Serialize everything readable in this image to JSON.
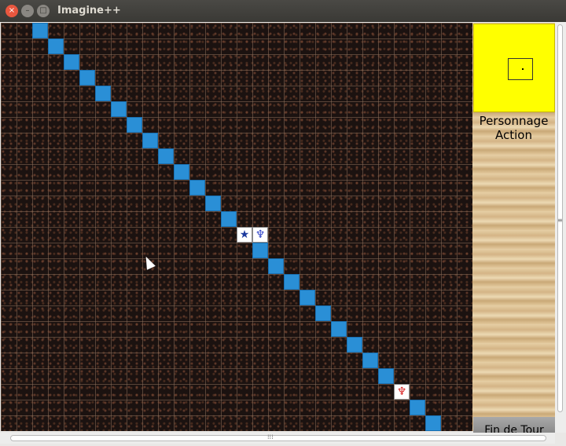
{
  "window": {
    "title": "Imagine++"
  },
  "window_buttons": {
    "close": "×",
    "minimize": "–",
    "maximize": "□"
  },
  "panel": {
    "labels": [
      "Personnage",
      "Action"
    ],
    "end_turn": "Fin de Tour"
  },
  "grid": {
    "columns": 30,
    "rows": 26
  },
  "path": [
    [
      2,
      0
    ],
    [
      3,
      1
    ],
    [
      4,
      2
    ],
    [
      5,
      3
    ],
    [
      6,
      4
    ],
    [
      7,
      5
    ],
    [
      8,
      6
    ],
    [
      9,
      7
    ],
    [
      10,
      8
    ],
    [
      11,
      9
    ],
    [
      12,
      10
    ],
    [
      13,
      11
    ],
    [
      14,
      12
    ],
    [
      16,
      14
    ],
    [
      17,
      15
    ],
    [
      18,
      16
    ],
    [
      19,
      17
    ],
    [
      20,
      18
    ],
    [
      21,
      19
    ],
    [
      22,
      20
    ],
    [
      23,
      21
    ],
    [
      24,
      22
    ],
    [
      26,
      24
    ],
    [
      27,
      25
    ]
  ],
  "units": [
    {
      "name": "blue-star-unit",
      "icon": "star",
      "color": "#1c3a9e",
      "cell": [
        15,
        13
      ]
    },
    {
      "name": "blue-demon-unit",
      "icon": "demon",
      "color": "#2b40c8",
      "cell": [
        16,
        13
      ]
    },
    {
      "name": "red-demon-unit",
      "icon": "demon",
      "color": "#d81e1e",
      "cell": [
        25,
        23
      ]
    }
  ],
  "colors": {
    "path": "#2a8fd6",
    "minimap": "#ffff00"
  }
}
